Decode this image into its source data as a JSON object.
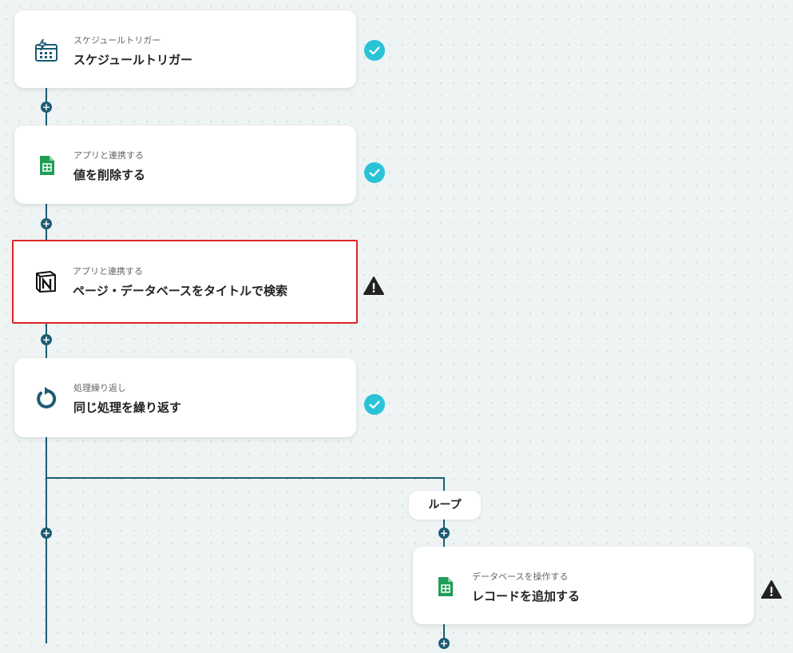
{
  "nodes": [
    {
      "category": "スケジュールトリガー",
      "title": "スケジュールトリガー",
      "icon": "schedule-trigger-icon",
      "status": "complete"
    },
    {
      "category": "アプリと連携する",
      "title": "値を削除する",
      "icon": "google-sheets-icon",
      "status": "complete"
    },
    {
      "category": "アプリと連携する",
      "title": "ページ・データベースをタイトルで検索",
      "icon": "notion-icon",
      "status": "warning"
    },
    {
      "category": "処理繰り返し",
      "title": "同じ処理を繰り返す",
      "icon": "loop-icon",
      "status": "complete"
    },
    {
      "category": "データベースを操作する",
      "title": "レコードを追加する",
      "icon": "google-sheets-icon",
      "status": "warning"
    }
  ],
  "loop_label": "ループ",
  "add_button": "+",
  "colors": {
    "connector": "#1d5c73",
    "check": "#29c3d8",
    "warning": "#222222",
    "selected_border": "#e02424",
    "sheets": "#1f9d55"
  }
}
